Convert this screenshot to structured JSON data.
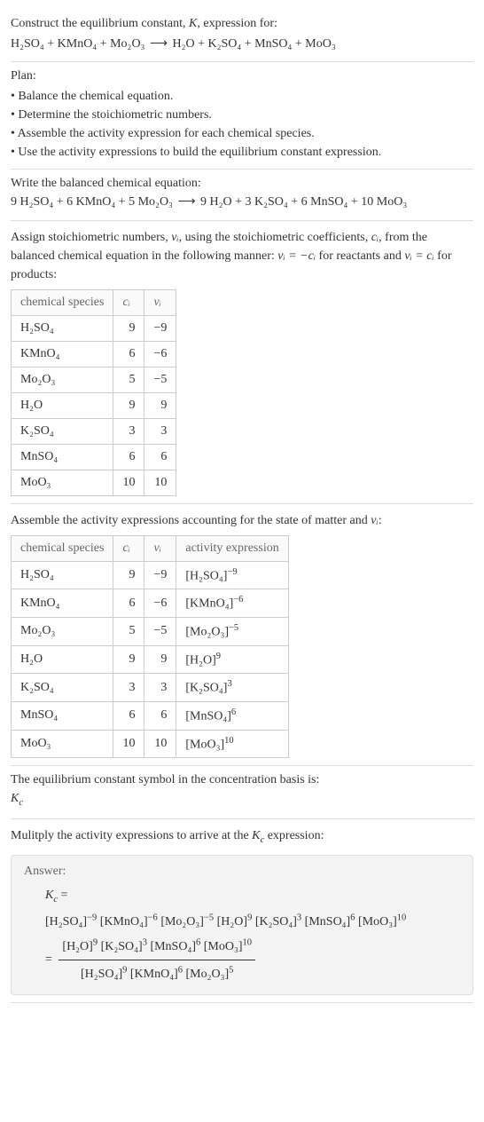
{
  "prompt": {
    "line1": "Construct the equilibrium constant, ",
    "Kital": "K",
    "line1b": ", expression for:",
    "eq_lhs": "H₂SO₄ + KMnO₄ + Mo₂O₃",
    "eq_arrow": "⟶",
    "eq_rhs": "H₂O + K₂SO₄ + MnSO₄ + MoO₃"
  },
  "plan": {
    "heading": "Plan:",
    "items": [
      "• Balance the chemical equation.",
      "• Determine the stoichiometric numbers.",
      "• Assemble the activity expression for each chemical species.",
      "• Use the activity expressions to build the equilibrium constant expression."
    ]
  },
  "balanced": {
    "heading": "Write the balanced chemical equation:",
    "eq_lhs": "9 H₂SO₄ + 6 KMnO₄ + 5 Mo₂O₃",
    "eq_arrow": "⟶",
    "eq_rhs": "9 H₂O + 3 K₂SO₄ + 6 MnSO₄ + 10 MoO₃"
  },
  "stoich": {
    "text1": "Assign stoichiometric numbers, ",
    "nu": "νᵢ",
    "text2": ", using the stoichiometric coefficients, ",
    "ci": "cᵢ",
    "text3": ", from the balanced chemical equation in the following manner: ",
    "rel1": "νᵢ = −cᵢ",
    "text4": " for reactants and ",
    "rel2": "νᵢ = cᵢ",
    "text5": " for products:",
    "headers": [
      "chemical species",
      "cᵢ",
      "νᵢ"
    ],
    "rows": [
      {
        "species": "H₂SO₄",
        "c": "9",
        "nu": "−9"
      },
      {
        "species": "KMnO₄",
        "c": "6",
        "nu": "−6"
      },
      {
        "species": "Mo₂O₃",
        "c": "5",
        "nu": "−5"
      },
      {
        "species": "H₂O",
        "c": "9",
        "nu": "9"
      },
      {
        "species": "K₂SO₄",
        "c": "3",
        "nu": "3"
      },
      {
        "species": "MnSO₄",
        "c": "6",
        "nu": "6"
      },
      {
        "species": "MoO₃",
        "c": "10",
        "nu": "10"
      }
    ]
  },
  "activity": {
    "heading": "Assemble the activity expressions accounting for the state of matter and ",
    "nu": "νᵢ",
    "colon": ":",
    "headers": [
      "chemical species",
      "cᵢ",
      "νᵢ",
      "activity expression"
    ],
    "rows": [
      {
        "species": "H₂SO₄",
        "c": "9",
        "nu": "−9",
        "expr_base": "[H₂SO₄]",
        "expr_pow": "−9"
      },
      {
        "species": "KMnO₄",
        "c": "6",
        "nu": "−6",
        "expr_base": "[KMnO₄]",
        "expr_pow": "−6"
      },
      {
        "species": "Mo₂O₃",
        "c": "5",
        "nu": "−5",
        "expr_base": "[Mo₂O₃]",
        "expr_pow": "−5"
      },
      {
        "species": "H₂O",
        "c": "9",
        "nu": "9",
        "expr_base": "[H₂O]",
        "expr_pow": "9"
      },
      {
        "species": "K₂SO₄",
        "c": "3",
        "nu": "3",
        "expr_base": "[K₂SO₄]",
        "expr_pow": "3"
      },
      {
        "species": "MnSO₄",
        "c": "6",
        "nu": "6",
        "expr_base": "[MnSO₄]",
        "expr_pow": "6"
      },
      {
        "species": "MoO₃",
        "c": "10",
        "nu": "10",
        "expr_base": "[MoO₃]",
        "expr_pow": "10"
      }
    ]
  },
  "symbol": {
    "heading": "The equilibrium constant symbol in the concentration basis is:",
    "value": "K",
    "sub": "c"
  },
  "multiply": {
    "heading1": "Mulitply the activity expressions to arrive at the ",
    "kc": "K",
    "kcsub": "c",
    "heading2": " expression:"
  },
  "answer": {
    "label": "Answer:",
    "kc": "K",
    "kcsub": "c",
    "eq": " = ",
    "terms": [
      {
        "base": "[H₂SO₄]",
        "pow": "−9"
      },
      {
        "base": "[KMnO₄]",
        "pow": "−6"
      },
      {
        "base": "[Mo₂O₃]",
        "pow": "−5"
      },
      {
        "base": "[H₂O]",
        "pow": "9"
      },
      {
        "base": "[K₂SO₄]",
        "pow": "3"
      },
      {
        "base": "[MnSO₄]",
        "pow": "6"
      },
      {
        "base": "[MoO₃]",
        "pow": "10"
      }
    ],
    "eq2": "= ",
    "frac_num": [
      {
        "base": "[H₂O]",
        "pow": "9"
      },
      {
        "base": "[K₂SO₄]",
        "pow": "3"
      },
      {
        "base": "[MnSO₄]",
        "pow": "6"
      },
      {
        "base": "[MoO₃]",
        "pow": "10"
      }
    ],
    "frac_den": [
      {
        "base": "[H₂SO₄]",
        "pow": "9"
      },
      {
        "base": "[KMnO₄]",
        "pow": "6"
      },
      {
        "base": "[Mo₂O₃]",
        "pow": "5"
      }
    ]
  }
}
